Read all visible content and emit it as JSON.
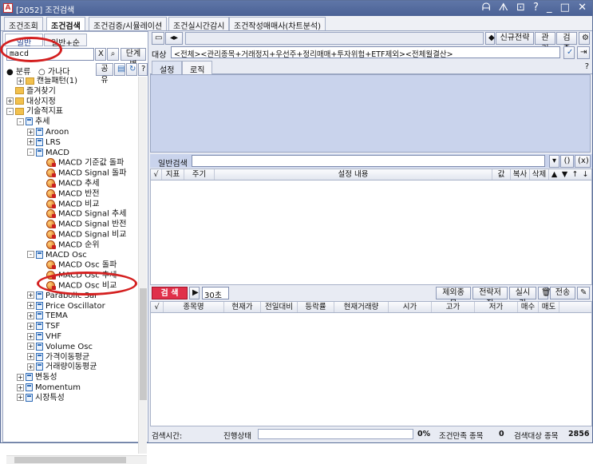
{
  "window": {
    "title": "[2052] 조건검색",
    "controls": "ᗩ ᗑ ⊡ ? _ □ ✕"
  },
  "main_tabs": [
    "조건조회",
    "조건검색",
    "조건검증/시뮬레이션",
    "조건실시간감시",
    "조건작성매매사(차트분석)"
  ],
  "left": {
    "subtabs": [
      "일반",
      "일반+순차"
    ],
    "search_value": "macd",
    "clear_label": "X",
    "step_button": "단계별",
    "filter": {
      "opt1": "분류",
      "opt2": "가나다",
      "share": "공유",
      "help": "?"
    },
    "tree": [
      {
        "label": "캔들패턴(1)",
        "kind": "folder",
        "level": 1,
        "exp": "+"
      },
      {
        "label": "즐겨찾기",
        "kind": "folder",
        "level": 0,
        "exp": ""
      },
      {
        "label": "대상지정",
        "kind": "folder",
        "level": 0,
        "exp": "+"
      },
      {
        "label": "기술적지표",
        "kind": "folder",
        "level": 0,
        "exp": "-"
      },
      {
        "label": "추세",
        "kind": "doc",
        "level": 1,
        "exp": "-"
      },
      {
        "label": "Aroon",
        "kind": "doc",
        "level": 2,
        "exp": "+"
      },
      {
        "label": "LRS",
        "kind": "doc",
        "level": 2,
        "exp": "+"
      },
      {
        "label": "MACD",
        "kind": "doc",
        "level": 2,
        "exp": "-"
      },
      {
        "label": "MACD 기준값 돌파",
        "kind": "cond",
        "level": 3,
        "exp": ""
      },
      {
        "label": "MACD Signal 돌파",
        "kind": "cond",
        "level": 3,
        "exp": ""
      },
      {
        "label": "MACD 추세",
        "kind": "cond",
        "level": 3,
        "exp": ""
      },
      {
        "label": "MACD 반전",
        "kind": "cond",
        "level": 3,
        "exp": ""
      },
      {
        "label": "MACD 비교",
        "kind": "cond",
        "level": 3,
        "exp": ""
      },
      {
        "label": "MACD Signal 추세",
        "kind": "cond",
        "level": 3,
        "exp": ""
      },
      {
        "label": "MACD Signal 반전",
        "kind": "cond",
        "level": 3,
        "exp": ""
      },
      {
        "label": "MACD Signal 비교",
        "kind": "cond",
        "level": 3,
        "exp": ""
      },
      {
        "label": "MACD 순위",
        "kind": "cond",
        "level": 3,
        "exp": ""
      },
      {
        "label": "MACD Osc",
        "kind": "doc",
        "level": 2,
        "exp": "-"
      },
      {
        "label": "MACD Osc 돌파",
        "kind": "cond",
        "level": 3,
        "exp": ""
      },
      {
        "label": "MACD Osc 추세",
        "kind": "cond",
        "level": 3,
        "exp": ""
      },
      {
        "label": "MACD Osc 비교",
        "kind": "cond",
        "level": 3,
        "exp": ""
      },
      {
        "label": "Parabolic Sar",
        "kind": "doc",
        "level": 2,
        "exp": "+"
      },
      {
        "label": "Price Oscillator",
        "kind": "doc",
        "level": 2,
        "exp": "+"
      },
      {
        "label": "TEMA",
        "kind": "doc",
        "level": 2,
        "exp": "+"
      },
      {
        "label": "TSF",
        "kind": "doc",
        "level": 2,
        "exp": "+"
      },
      {
        "label": "VHF",
        "kind": "doc",
        "level": 2,
        "exp": "+"
      },
      {
        "label": "Volume Osc",
        "kind": "doc",
        "level": 2,
        "exp": "+"
      },
      {
        "label": "가격이동평균",
        "kind": "doc",
        "level": 2,
        "exp": "+"
      },
      {
        "label": "거래량이동평균",
        "kind": "doc",
        "level": 2,
        "exp": "+"
      },
      {
        "label": "변동성",
        "kind": "doc",
        "level": 1,
        "exp": "+"
      },
      {
        "label": "Momentum",
        "kind": "doc",
        "level": 1,
        "exp": "+"
      },
      {
        "label": "시장특성",
        "kind": "doc",
        "level": 1,
        "exp": "+"
      }
    ]
  },
  "right": {
    "toolbar": {
      "new_strategy": "신규전략",
      "manage": "관리",
      "verify": "검증"
    },
    "target_label": "대상",
    "target_value": "<전체><관리종목+거래정지+우선주+정리매매+투자위험+ETF제외><전체월결산>",
    "tabs": [
      "설정",
      "로직"
    ],
    "general_search_label": "일반검색",
    "cond_headers": [
      "√",
      "지표",
      "주기",
      "설정 내용",
      "값",
      "복사",
      "삭제",
      "▲",
      "▼",
      "↑",
      "↓"
    ],
    "search_button": "검 색",
    "interval": "30초",
    "buttons": {
      "exclude": "제외종목",
      "save": "전략저장",
      "realtime": "실시간",
      "send": "전송"
    },
    "result_headers": [
      "√",
      "종목명",
      "현재가",
      "전일대비",
      "등락률",
      "현재거래량",
      "시가",
      "고가",
      "저가",
      "매수",
      "매도"
    ]
  },
  "status": {
    "time_label": "검색시간:",
    "progress_label": "진행상태",
    "percent": "0%",
    "match_label": "조건만족 종목",
    "match_count": "0",
    "target_label": "검색대상 종목",
    "target_count": "2856"
  }
}
